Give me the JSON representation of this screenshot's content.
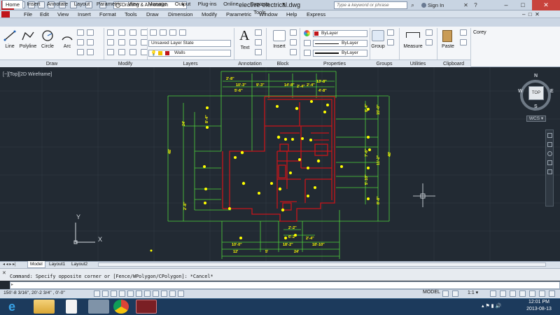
{
  "titlebar": {
    "workspace": "Drafting & Annotation",
    "document_title": "elective-electrical.dwg",
    "search_placeholder": "Type a keyword or phrase",
    "signin": "Sign In"
  },
  "menus": [
    "File",
    "Edit",
    "View",
    "Insert",
    "Format",
    "Tools",
    "Draw",
    "Dimension",
    "Modify",
    "Parametric",
    "Window",
    "Help",
    "Express"
  ],
  "ribbon_tabs": [
    "Home",
    "Insert",
    "Annotate",
    "Layout",
    "Parametric",
    "View",
    "Manage",
    "Output",
    "Plug-ins",
    "Online",
    "Express Tools"
  ],
  "ribbon": {
    "draw": {
      "label": "Draw",
      "line": "Line",
      "polyline": "Polyline",
      "circle": "Circle",
      "arc": "Arc"
    },
    "modify": {
      "label": "Modify"
    },
    "layers": {
      "label": "Layers",
      "state": "Unsaved Layer State",
      "current": "Walls"
    },
    "annotation": {
      "label": "Annotation",
      "text": "Text"
    },
    "block": {
      "label": "Block",
      "insert": "Insert"
    },
    "properties": {
      "label": "Properties",
      "color": "ByLayer",
      "linetype": "ByLayer",
      "lineweight": "ByLayer"
    },
    "groups": {
      "label": "Groups",
      "group": "Group"
    },
    "utilities": {
      "label": "Utilities",
      "measure": "Measure"
    },
    "clipboard": {
      "label": "Clipboard",
      "paste": "Paste"
    },
    "user": {
      "label": "Corey"
    }
  },
  "viewport_label": "[−][Top][2D Wireframe]",
  "viewcube": {
    "top": "TOP",
    "n": "N",
    "s": "S",
    "e": "E",
    "w": "W",
    "wcs": "WCS ▾"
  },
  "ucs": {
    "x": "X",
    "y": "Y"
  },
  "layout_tabs": [
    "Model",
    "Layout1",
    "Layout2"
  ],
  "command": {
    "history": "Command: Specify opposite corner or [Fence/WPolygon/CPolygon]: *Cancel*",
    "prompt": ""
  },
  "status": {
    "coords": "150'-8 3/16\", 20'-2 3/4\" , 0'-0\"",
    "model": "MODEL",
    "scale": "1:1 ▾"
  },
  "dims_top": [
    "2'-8\"",
    "10'-3\"",
    "9'-3\"",
    "14'-8\"",
    "2'-4\"",
    "2'-4\"",
    "13'-8\"",
    "5'-6\"",
    "4'-8\""
  ],
  "dims_bottom": [
    "2'-2\"",
    "6'-2\"",
    "2'-4\"",
    "10'-0\"",
    "12'",
    "18'-2\"",
    "18'-10\"",
    "5'",
    "24'"
  ],
  "dims_left": [
    "24'",
    "48'",
    "8'-4\"",
    "2'-8\""
  ],
  "dims_right": [
    "15'-0\"",
    "7'-6\"",
    "11'-2\"",
    "5'-10\"",
    "8'-8\"",
    "48'",
    "8'-4\""
  ],
  "tray": {
    "time": "12:01 PM",
    "date": "2013-08-13"
  },
  "colors": {
    "accent": "#c0141a",
    "canvas": "#222a33",
    "walls": "#c8141a",
    "dims": "#4fd33a",
    "labels": "#ffff00"
  }
}
